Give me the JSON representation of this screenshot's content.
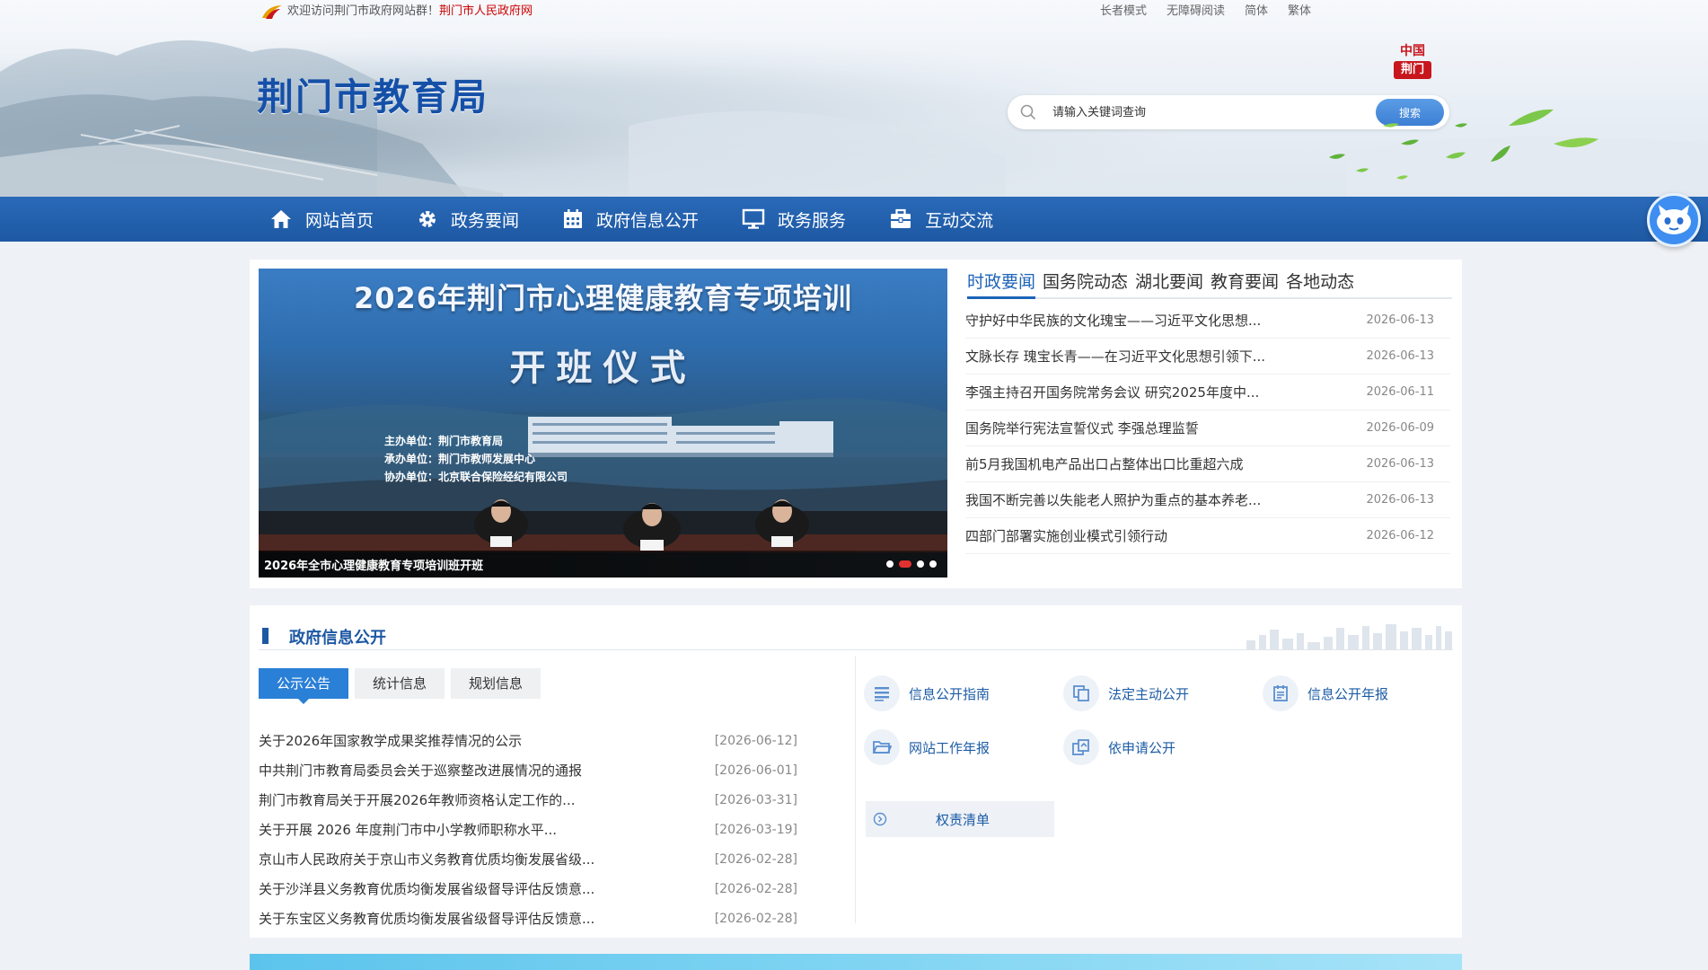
{
  "topbar": {
    "welcome": "欢迎访问荆门市政府网站群！",
    "site_link": "荆门市人民政府网",
    "tools": [
      "长者模式",
      "无障碍阅读",
      "简体",
      "繁体"
    ]
  },
  "header": {
    "title": "荆门市教育局",
    "seal_top": "中国",
    "seal_bottom": "荆门",
    "search_placeholder": "请输入关键词查询",
    "search_button": "搜索"
  },
  "nav": {
    "items": [
      {
        "label": "网站首页",
        "icon": "home-icon"
      },
      {
        "label": "政务要闻",
        "icon": "gear-icon"
      },
      {
        "label": "政府信息公开",
        "icon": "calendar-icon"
      },
      {
        "label": "政务服务",
        "icon": "monitor-icon"
      },
      {
        "label": "互动交流",
        "icon": "briefcase-icon"
      }
    ]
  },
  "carousel": {
    "banner_title": "2026年荆门市心理健康教育专项培训",
    "banner_sub": "开班仪式",
    "org_lines": [
      "主办单位：荆门市教育局",
      "承办单位：荆门市教师发展中心",
      "协办单位：北京联合保险经纪有限公司"
    ],
    "caption": "2026年全市心理健康教育专项培训班开班",
    "dot_count": 4,
    "active_dot": 1
  },
  "news": {
    "tabs": [
      "时政要闻",
      "国务院动态",
      "湖北要闻",
      "教育要闻",
      "各地动态"
    ],
    "active_tab": 0,
    "items": [
      {
        "title": "守护好中华民族的文化瑰宝——习近平文化思想...",
        "date": "2026-06-13"
      },
      {
        "title": "文脉长存 瑰宝长青——在习近平文化思想引领下...",
        "date": "2026-06-13"
      },
      {
        "title": "李强主持召开国务院常务会议 研究2025年度中...",
        "date": "2026-06-11"
      },
      {
        "title": "国务院举行宪法宣誓仪式 李强总理监誓",
        "date": "2026-06-09"
      },
      {
        "title": "前5月我国机电产品出口占整体出口比重超六成",
        "date": "2026-06-13"
      },
      {
        "title": "我国不断完善以失能老人照护为重点的基本养老...",
        "date": "2026-06-13"
      },
      {
        "title": "四部门部署实施创业模式引领行动",
        "date": "2026-06-12"
      }
    ]
  },
  "gov_info": {
    "title": "政府信息公开",
    "tabs": [
      "公示公告",
      "统计信息",
      "规划信息"
    ],
    "active_tab": 0,
    "notices": [
      {
        "title": "关于2026年国家教学成果奖推荐情况的公示",
        "date": "[2026-06-12]"
      },
      {
        "title": "中共荆门市教育局委员会关于巡察整改进展情况的通报",
        "date": "[2026-06-01]"
      },
      {
        "title": "荆门市教育局关于开展2026年教师资格认定工作的...",
        "date": "[2026-03-31]"
      },
      {
        "title": "关于开展 2026 年度荆门市中小学教师职称水平...",
        "date": "[2026-03-19]"
      },
      {
        "title": "京山市人民政府关于京山市义务教育优质均衡发展省级...",
        "date": "[2026-02-28]"
      },
      {
        "title": "关于沙洋县义务教育优质均衡发展省级督导评估反馈意...",
        "date": "[2026-02-28]"
      },
      {
        "title": "关于东宝区义务教育优质均衡发展省级督导评估反馈意...",
        "date": "[2026-02-28]"
      }
    ],
    "quick_links": [
      {
        "label": "信息公开指南",
        "icon": "list-icon"
      },
      {
        "label": "法定主动公开",
        "icon": "copy-icon"
      },
      {
        "label": "信息公开年报",
        "icon": "report-icon"
      },
      {
        "label": "网站工作年报",
        "icon": "folder-icon"
      },
      {
        "label": "依申请公开",
        "icon": "documents-icon"
      }
    ],
    "power_list": "权责清单"
  },
  "colors": {
    "primary_blue": "#1d58a3",
    "accent_red": "#e03232",
    "tab_blue": "#2a7fd6"
  }
}
